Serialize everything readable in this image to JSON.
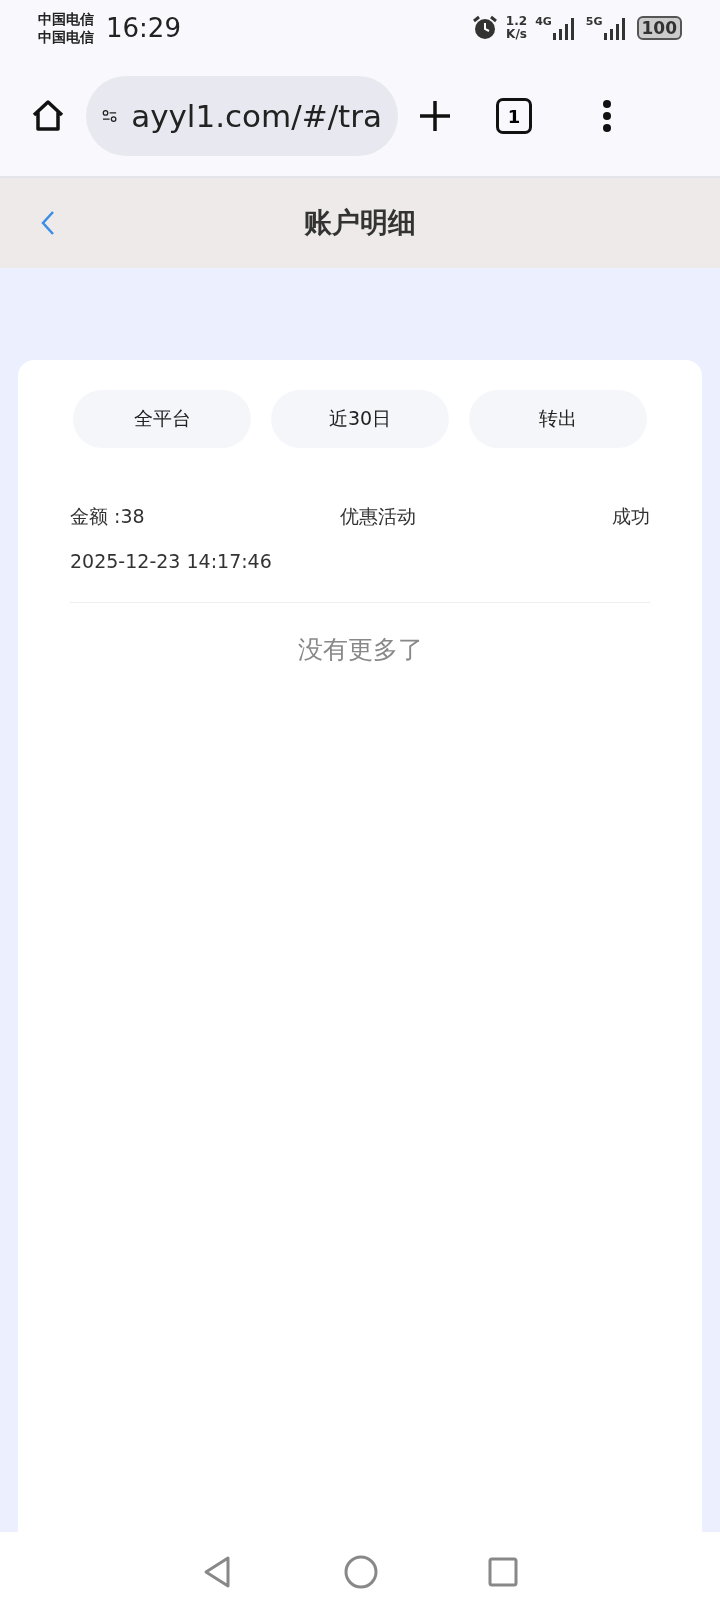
{
  "status_bar": {
    "carriers": [
      "中国电信",
      "中国电信"
    ],
    "time": "16:29",
    "net_speed": [
      "1.2",
      "K/s"
    ],
    "networks": [
      "4G",
      "5G"
    ],
    "battery": "100"
  },
  "browser": {
    "url": "ayyl1.com/#/tra",
    "tab_count": "1"
  },
  "header": {
    "title": "账户明细"
  },
  "filters": [
    "全平台",
    "近30日",
    "转出"
  ],
  "records": [
    {
      "amount": "金额 :38",
      "type": "优惠活动",
      "status": "成功",
      "time": "2025-12-23 14:17:46"
    }
  ],
  "end_text": "没有更多了"
}
